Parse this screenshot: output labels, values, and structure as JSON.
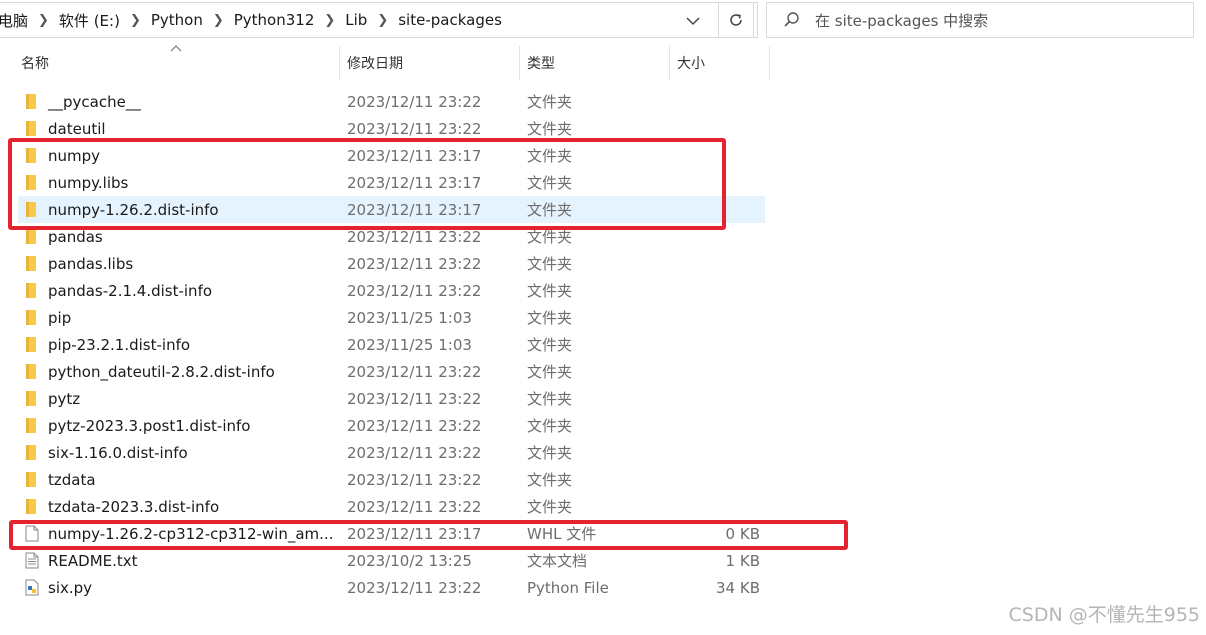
{
  "address_bar": {
    "breadcrumbs": [
      "电脑",
      "软件 (E:)",
      "Python",
      "Python312",
      "Lib",
      "site-packages"
    ]
  },
  "search": {
    "placeholder": "在 site-packages 中搜索"
  },
  "columns": {
    "name": "名称",
    "date": "修改日期",
    "type": "类型",
    "size": "大小"
  },
  "files": [
    {
      "name": "__pycache__",
      "date": "2023/12/11 23:22",
      "type": "文件夹",
      "size": "",
      "icon": "folder-icon"
    },
    {
      "name": "dateutil",
      "date": "2023/12/11 23:22",
      "type": "文件夹",
      "size": "",
      "icon": "folder-icon"
    },
    {
      "name": "numpy",
      "date": "2023/12/11 23:17",
      "type": "文件夹",
      "size": "",
      "icon": "folder-icon"
    },
    {
      "name": "numpy.libs",
      "date": "2023/12/11 23:17",
      "type": "文件夹",
      "size": "",
      "icon": "folder-icon"
    },
    {
      "name": "numpy-1.26.2.dist-info",
      "date": "2023/12/11 23:17",
      "type": "文件夹",
      "size": "",
      "icon": "folder-icon",
      "selected": true
    },
    {
      "name": "pandas",
      "date": "2023/12/11 23:22",
      "type": "文件夹",
      "size": "",
      "icon": "folder-icon"
    },
    {
      "name": "pandas.libs",
      "date": "2023/12/11 23:22",
      "type": "文件夹",
      "size": "",
      "icon": "folder-icon"
    },
    {
      "name": "pandas-2.1.4.dist-info",
      "date": "2023/12/11 23:22",
      "type": "文件夹",
      "size": "",
      "icon": "folder-icon"
    },
    {
      "name": "pip",
      "date": "2023/11/25 1:03",
      "type": "文件夹",
      "size": "",
      "icon": "folder-icon"
    },
    {
      "name": "pip-23.2.1.dist-info",
      "date": "2023/11/25 1:03",
      "type": "文件夹",
      "size": "",
      "icon": "folder-icon"
    },
    {
      "name": "python_dateutil-2.8.2.dist-info",
      "date": "2023/12/11 23:22",
      "type": "文件夹",
      "size": "",
      "icon": "folder-icon"
    },
    {
      "name": "pytz",
      "date": "2023/12/11 23:22",
      "type": "文件夹",
      "size": "",
      "icon": "folder-icon"
    },
    {
      "name": "pytz-2023.3.post1.dist-info",
      "date": "2023/12/11 23:22",
      "type": "文件夹",
      "size": "",
      "icon": "folder-icon"
    },
    {
      "name": "six-1.16.0.dist-info",
      "date": "2023/12/11 23:22",
      "type": "文件夹",
      "size": "",
      "icon": "folder-icon"
    },
    {
      "name": "tzdata",
      "date": "2023/12/11 23:22",
      "type": "文件夹",
      "size": "",
      "icon": "folder-icon"
    },
    {
      "name": "tzdata-2023.3.dist-info",
      "date": "2023/12/11 23:22",
      "type": "文件夹",
      "size": "",
      "icon": "folder-icon"
    },
    {
      "name": "numpy-1.26.2-cp312-cp312-win_am...",
      "date": "2023/12/11 23:17",
      "type": "WHL 文件",
      "size": "0 KB",
      "icon": "file-icon"
    },
    {
      "name": "README.txt",
      "date": "2023/10/2 13:25",
      "type": "文本文档",
      "size": "1 KB",
      "icon": "text-file-icon"
    },
    {
      "name": "six.py",
      "date": "2023/12/11 23:22",
      "type": "Python File",
      "size": "34 KB",
      "icon": "python-file-icon"
    }
  ],
  "colors": {
    "highlight": "#e3232e",
    "selection": "#e5f3ff",
    "folder": "#f8c94a"
  },
  "watermark": "CSDN @不懂先生955"
}
